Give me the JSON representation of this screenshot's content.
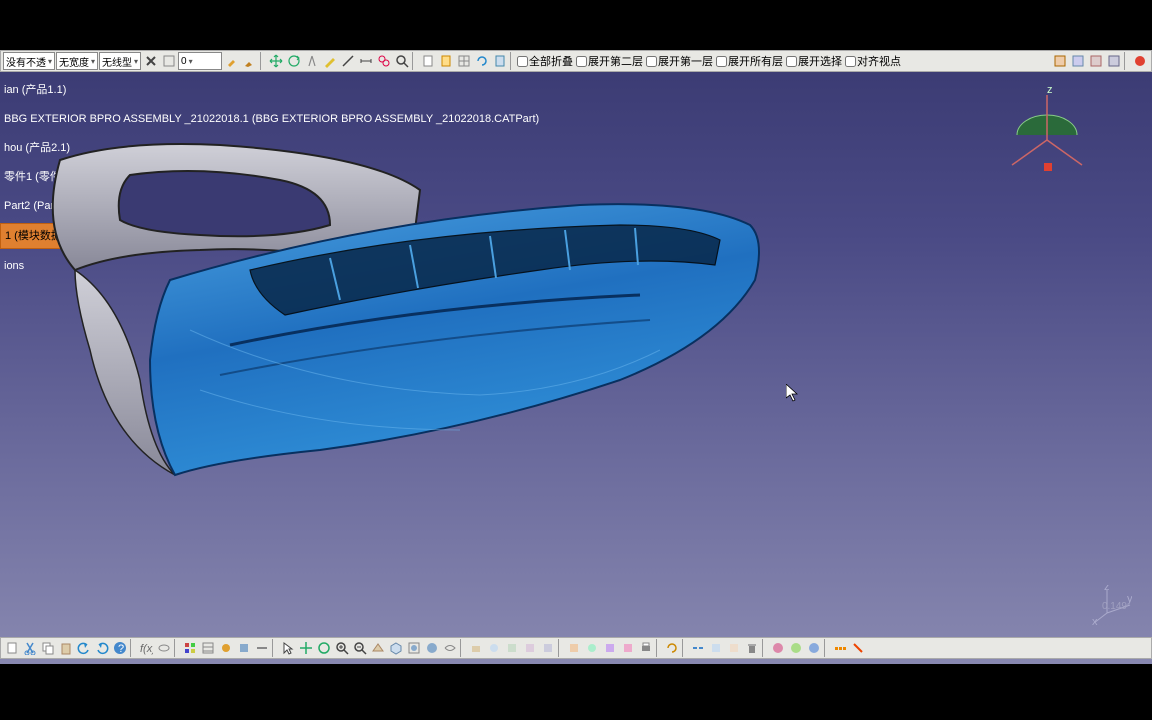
{
  "topbar": {
    "dd_transparency": "没有不透",
    "dd_width": "无宽度",
    "dd_line": "无线型",
    "dd_num": "0",
    "chk_collapse_all": "全部折叠",
    "chk_expand_l2": "展开第二层",
    "chk_expand_l1": "展开第一层",
    "chk_expand_all": "展开所有层",
    "chk_expand_sel": "展开选择",
    "chk_align_view": "对齐视点"
  },
  "tree": {
    "n1": "ian (产品1.1)",
    "n2": "BBG EXTERIOR BPRO ASSEMBLY _21022018.1 (BBG EXTERIOR BPRO ASSEMBLY _21022018.CATPart)",
    "n3": "hou (产品2.1)",
    "n4": "零件1 (零件1.1)",
    "n5": "Part2 (Part2.1)",
    "n6": "1 (模块数据)",
    "n7": "ions"
  },
  "axis": {
    "x": "x",
    "y": "y",
    "z": "z"
  },
  "scale": "0.149"
}
